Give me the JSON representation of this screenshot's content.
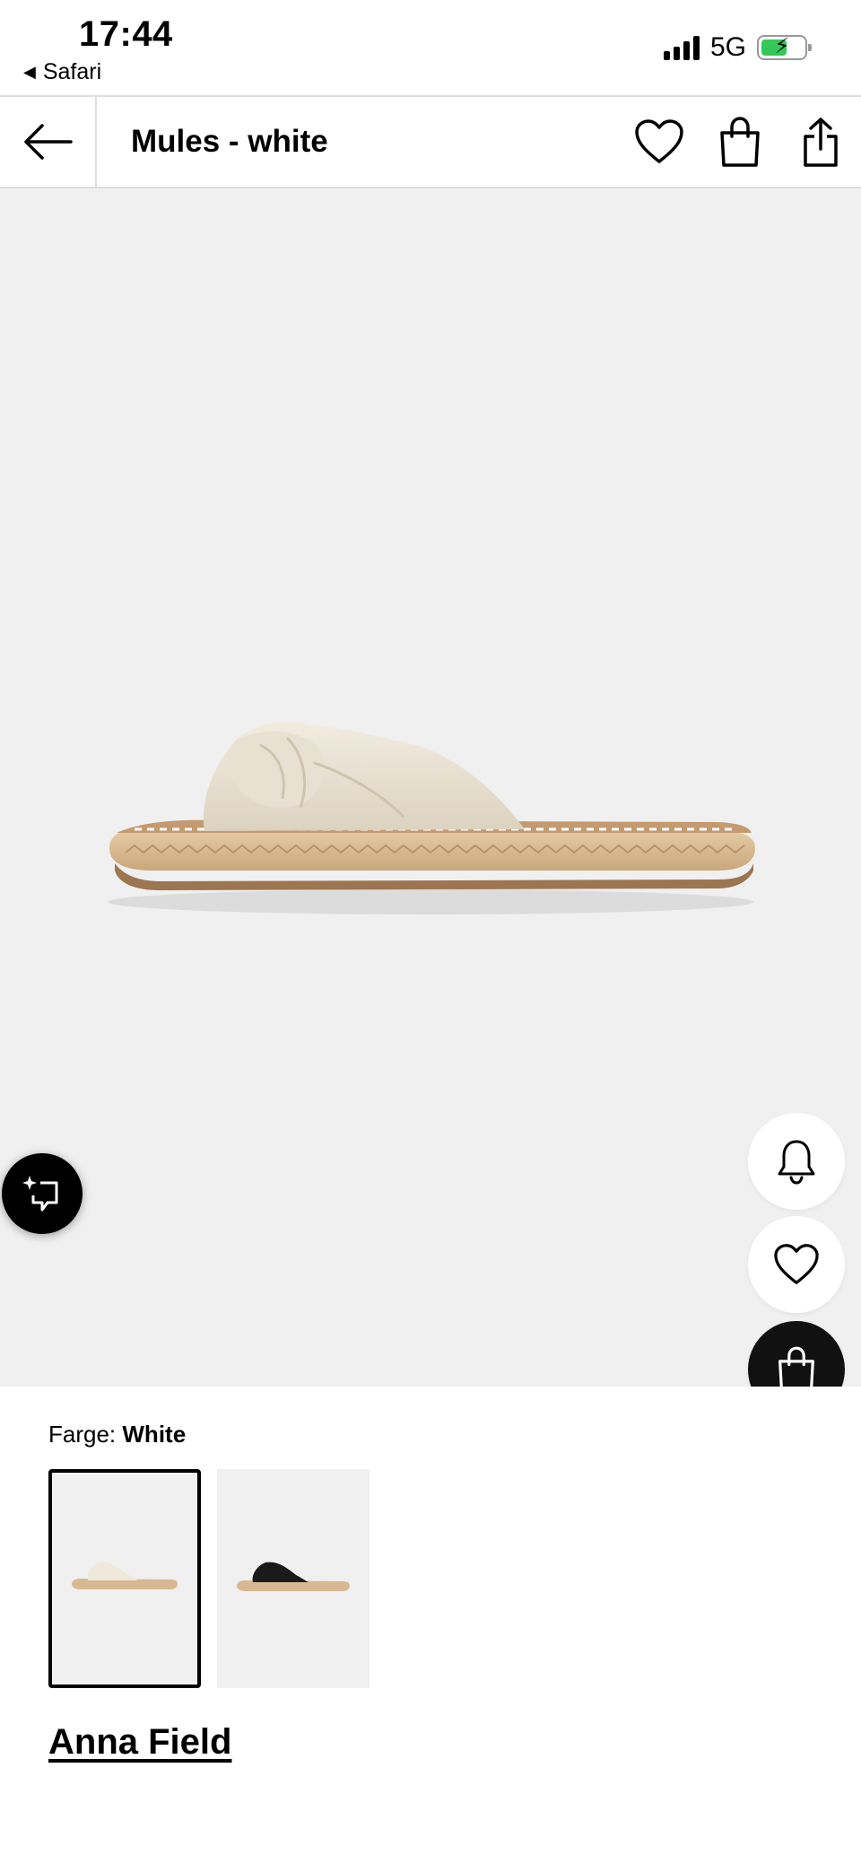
{
  "status_bar": {
    "time": "17:44",
    "back_app": "Safari",
    "network": "5G",
    "icons": [
      "signal-icon",
      "battery-charging-icon"
    ]
  },
  "nav": {
    "title": "Mules - white",
    "icons": [
      "back-arrow-icon",
      "heart-icon",
      "bag-icon",
      "share-icon"
    ]
  },
  "product_image": {
    "floating_buttons": [
      "ai-assistant-icon",
      "bell-icon",
      "heart-icon",
      "bag-icon"
    ]
  },
  "colors": {
    "label": "Farge:",
    "selected": "White",
    "swatches": [
      {
        "name": "White",
        "selected": true
      },
      {
        "name": "Black",
        "selected": false
      }
    ]
  },
  "brand": "Anna Field",
  "theme": {
    "hero_background": "#f0f0f0",
    "battery_green": "#34c759",
    "text": "#000000"
  }
}
